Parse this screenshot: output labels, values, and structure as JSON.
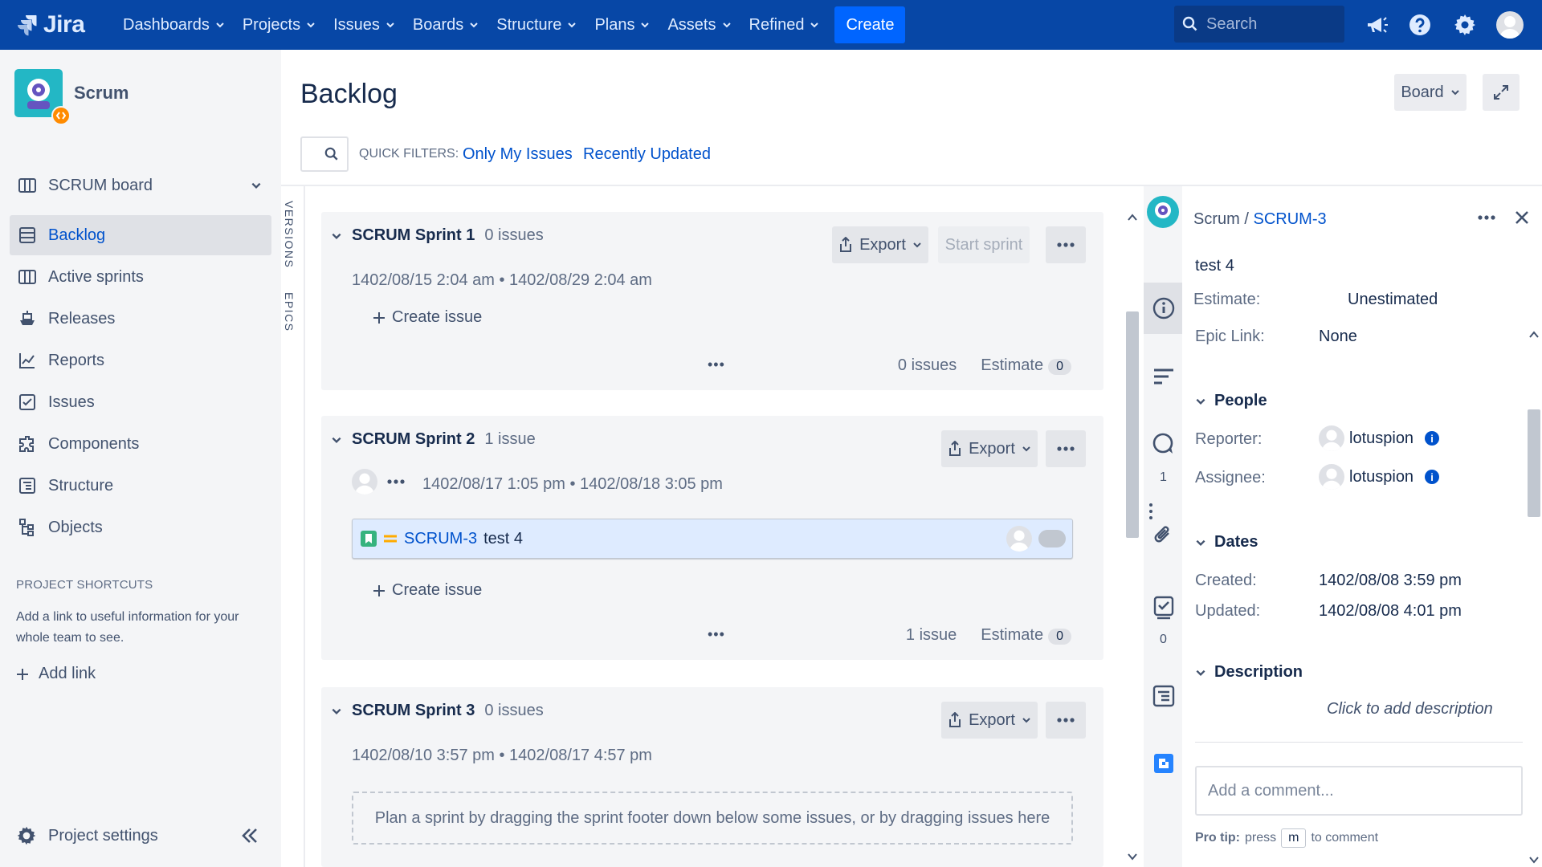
{
  "topnav": {
    "logo_text": "Jira",
    "items": [
      {
        "label": "Dashboards"
      },
      {
        "label": "Projects"
      },
      {
        "label": "Issues"
      },
      {
        "label": "Boards"
      },
      {
        "label": "Structure"
      },
      {
        "label": "Plans"
      },
      {
        "label": "Assets"
      },
      {
        "label": "Refined"
      }
    ],
    "create_label": "Create",
    "search_placeholder": "Search",
    "colors": {
      "bar": "#0747a6",
      "create": "#0065ff"
    }
  },
  "sidebar": {
    "project_name": "Scrum",
    "board_selector": "SCRUM board",
    "items": [
      {
        "label": "Backlog",
        "icon": "backlog-icon",
        "active": true
      },
      {
        "label": "Active sprints",
        "icon": "board-icon"
      },
      {
        "label": "Releases",
        "icon": "ship-icon"
      },
      {
        "label": "Reports",
        "icon": "chart-icon"
      },
      {
        "label": "Issues",
        "icon": "issues-icon"
      },
      {
        "label": "Components",
        "icon": "puzzle-icon"
      },
      {
        "label": "Structure",
        "icon": "structure-icon"
      },
      {
        "label": "Objects",
        "icon": "objects-icon"
      }
    ],
    "shortcuts_title": "PROJECT SHORTCUTS",
    "shortcuts_desc": "Add a link to useful information for your whole team to see.",
    "add_link": "Add link",
    "project_settings": "Project settings"
  },
  "main": {
    "title": "Backlog",
    "board_button": "Board",
    "quick_filters_label": "QUICK FILTERS:",
    "quick_filters": [
      "Only My Issues",
      "Recently Updated"
    ],
    "vertical_tabs": [
      "VERSIONS",
      "EPICS"
    ]
  },
  "sprints": [
    {
      "name": "SCRUM Sprint 1",
      "count": "0 issues",
      "start": "1402/08/15 2:04 am",
      "end": "1402/08/29 2:04 am",
      "export": "Export",
      "start_sprint": "Start sprint",
      "create_issue": "Create issue",
      "footer_count": "0 issues",
      "estimate_label": "Estimate",
      "estimate_value": "0"
    },
    {
      "name": "SCRUM Sprint 2",
      "count": "1 issue",
      "start": "1402/08/17 1:05 pm",
      "end": "1402/08/18 3:05 pm",
      "export": "Export",
      "create_issue": "Create issue",
      "footer_count": "1 issue",
      "estimate_label": "Estimate",
      "estimate_value": "0",
      "issues": [
        {
          "key": "SCRUM-3",
          "summary": "test 4"
        }
      ]
    },
    {
      "name": "SCRUM Sprint 3",
      "count": "0 issues",
      "start": "1402/08/10 3:57 pm",
      "end": "1402/08/17 4:57 pm",
      "export": "Export",
      "plan_hint": "Plan a sprint by dragging the sprint footer down below some issues, or by dragging issues here"
    }
  ],
  "detail": {
    "project": "Scrum",
    "separator": "/",
    "issue_key": "SCRUM-3",
    "summary": "test 4",
    "estimate_label": "Estimate:",
    "estimate_value": "Unestimated",
    "epic_label": "Epic Link:",
    "epic_value": "None",
    "people_title": "People",
    "reporter_label": "Reporter:",
    "reporter": "lotuspion",
    "assignee_label": "Assignee:",
    "assignee": "lotuspion",
    "dates_title": "Dates",
    "created_label": "Created:",
    "created": "1402/08/08 3:59 pm",
    "updated_label": "Updated:",
    "updated": "1402/08/08 4:01 pm",
    "description_title": "Description",
    "description_placeholder": "Click to add description",
    "comment_placeholder": "Add a comment...",
    "pro_tip_label": "Pro tip:",
    "pro_tip_press": "press",
    "pro_tip_key": "m",
    "pro_tip_rest": "to comment",
    "strip_counts": {
      "comments": "1",
      "checklist": "0"
    }
  }
}
